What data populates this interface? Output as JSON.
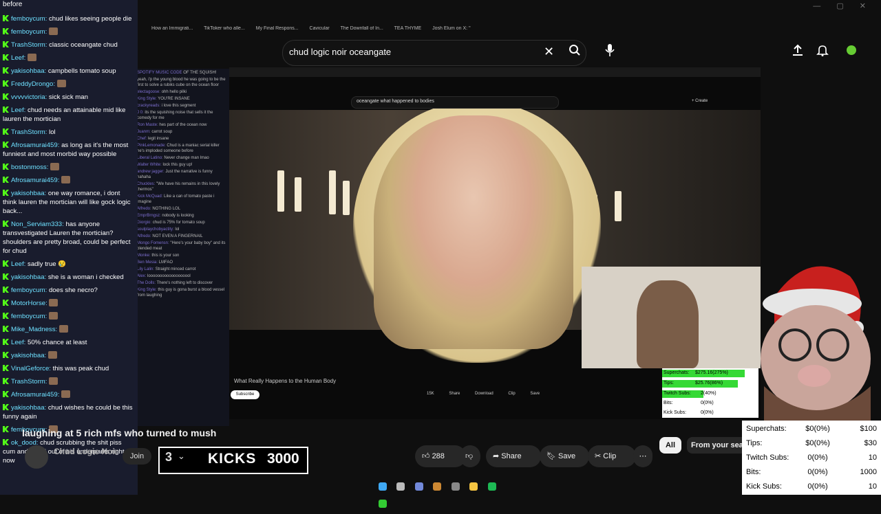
{
  "browser": {
    "search_query": "chud logic noir oceangate",
    "bookmarks": [
      "How an Immigrati...",
      "TikToker who alle...",
      "My Final Respons...",
      "Cavicular",
      "The Downfall of In...",
      "TEA THYME",
      "Josh Elum on X: \""
    ]
  },
  "chat": {
    "header": "before",
    "messages": [
      {
        "user": "femboycum:",
        "text": "chud likes seeing people die"
      },
      {
        "user": "femboycum:",
        "text": ""
      },
      {
        "user": "TrashStorm:",
        "text": "classic oceangate chud"
      },
      {
        "user": "Leef:",
        "text": ""
      },
      {
        "user": "yakisohbaa:",
        "text": "campbells tomato soup"
      },
      {
        "user": "FreddyDrongo:",
        "text": ""
      },
      {
        "user": "vvvvvictoria:",
        "text": "sick sick man"
      },
      {
        "user": "Leef:",
        "text": "chud needs an attainable mid like lauren the mortician"
      },
      {
        "user": "TrashStorm:",
        "text": "lol"
      },
      {
        "user": "Afrosamurai459:",
        "text": "as long as it's the most funniest and most morbid way possible"
      },
      {
        "user": "bostonmoss:",
        "text": ""
      },
      {
        "user": "Afrosamurai459:",
        "text": ""
      },
      {
        "user": "yakisohbaa:",
        "text": "one way romance, i dont think lauren the mortician will like gock logic back..."
      },
      {
        "user": "Non_Serviam333:",
        "text": "has anyone transvestigated Lauren the mortician? shoulders are pretty broad, could be perfect for chud"
      },
      {
        "user": "Leef:",
        "text": "sadly true 😢"
      },
      {
        "user": "yakisohbaa:",
        "text": "she is a woman i checked"
      },
      {
        "user": "femboycum:",
        "text": "does she necro?"
      },
      {
        "user": "MotorHorse:",
        "text": ""
      },
      {
        "user": "femboycum:",
        "text": ""
      },
      {
        "user": "Mike_Madness:",
        "text": ""
      },
      {
        "user": "Leef:",
        "text": "50% chance at least"
      },
      {
        "user": "yakisohbaa:",
        "text": ""
      },
      {
        "user": "VinalGeforce:",
        "text": "this was peak chud"
      },
      {
        "user": "TrashStorm:",
        "text": ""
      },
      {
        "user": "Afrosamurai459:",
        "text": ""
      },
      {
        "user": "yakisohbaa:",
        "text": "chud wishes he could be this funny again"
      },
      {
        "user": "femboycum:",
        "text": ""
      },
      {
        "user": "ok_dood:",
        "text": "chud scrubbing the shit piss cum and blood out of his underpants right now"
      }
    ]
  },
  "inner_stream": {
    "search": "oceangate what happened to bodies",
    "create": "+ Create",
    "video_title": "What Really Happens to the Human Body",
    "subscribe": "Subscribe",
    "actions": [
      "15K",
      "Share",
      "Download",
      "Clip",
      "Save"
    ],
    "ghost_chat": [
      {
        "u": "SPOTIFY MUSIC CODE",
        "t": "OF THE SQUISH!"
      },
      {
        "u": "",
        "t": "yeah, i'p the young blood he was going to be the first to solve a rubiks cube on the ocean floor"
      },
      {
        "u": "electagoose:",
        "t": "ohh hello pilki"
      },
      {
        "u": "King Style:",
        "t": "YOU'RE INSANE"
      },
      {
        "u": "crackyreads:",
        "t": "i love this segment"
      },
      {
        "u": "J 0:",
        "t": "its the squishing noise that sells it the comedy for me"
      },
      {
        "u": "Ron Maste:",
        "t": "hes part of the ocean now"
      },
      {
        "u": "Juanm:",
        "t": "carrot soup"
      },
      {
        "u": "Chef:",
        "t": "legit insane"
      },
      {
        "u": "PinkLemonade:",
        "t": "Chud is a maniac serial killer he's imploded someone before"
      },
      {
        "u": "Liberal Latino:",
        "t": "Never change man lmao"
      },
      {
        "u": "Walter White:",
        "t": "lock this guy up!"
      },
      {
        "u": "andrew jagger:",
        "t": "Just the narrative is funny hahaha"
      },
      {
        "u": "Chuckles:",
        "t": "\"We have his remains in this lovely thermos\""
      },
      {
        "u": "Kick McQuad:",
        "t": "Like a can of tomato paste i imagine"
      },
      {
        "u": "Alfredo:",
        "t": "NOTHING LOL"
      },
      {
        "u": "EmprBrngsz:",
        "t": "nobody is looking"
      },
      {
        "u": "Giorgio:",
        "t": "chud is 75% for tomato soup"
      },
      {
        "u": "soulplaychobyactity:",
        "t": "lol"
      },
      {
        "u": "Alfredo:",
        "t": "NOT EVEN A FINGERNAIL"
      },
      {
        "u": "Mongo Fomensn:",
        "t": "\"Here's your baby boy\" and its blended meat"
      },
      {
        "u": "Monke:",
        "t": "this is your son"
      },
      {
        "u": "Ben Mesia:",
        "t": "LMFAO"
      },
      {
        "u": "Lily Lalin:",
        "t": "Straight minced carrot"
      },
      {
        "u": "Alex:",
        "t": "looooooooooooooooool"
      },
      {
        "u": "The Dolls:",
        "t": "There's nothing left to discover"
      },
      {
        "u": "King Style:",
        "t": "this guy is gona burst a blood vessel from laughing"
      }
    ]
  },
  "video": {
    "title": "laughing at 5 rich mfs who turned to mush",
    "channel": "Chud Logic Noir",
    "join": "Join",
    "kicks_label": "KICKS",
    "kicks_total": "3000",
    "kicks_count": "3",
    "like_count": "288",
    "share": "Share",
    "save": "Save",
    "clip": "Clip",
    "chip_all": "All",
    "chip_from": "From your search"
  },
  "donations": [
    {
      "label": "Superchats:",
      "value": "$0(0%)",
      "goal": "$100"
    },
    {
      "label": "Tips:",
      "value": "$0(0%)",
      "goal": "$30"
    },
    {
      "label": "Twitch Subs:",
      "value": "0(0%)",
      "goal": "10"
    },
    {
      "label": "Bits:",
      "value": "0(0%)",
      "goal": "1000"
    },
    {
      "label": "Kick Subs:",
      "value": "0(0%)",
      "goal": "10"
    }
  ],
  "mini_overlay": [
    {
      "label": "Superchats:",
      "value": "$275.16(275%)",
      "goal": "$100"
    },
    {
      "label": "Tips:",
      "value": "$25.76(86%)",
      "goal": "$30"
    },
    {
      "label": "Twitch Subs:",
      "value": "2(40%)",
      "goal": ""
    },
    {
      "label": "Bits:",
      "value": "0(0%)",
      "goal": ""
    },
    {
      "label": "Kick Subs:",
      "value": "0(0%)",
      "goal": ""
    }
  ]
}
